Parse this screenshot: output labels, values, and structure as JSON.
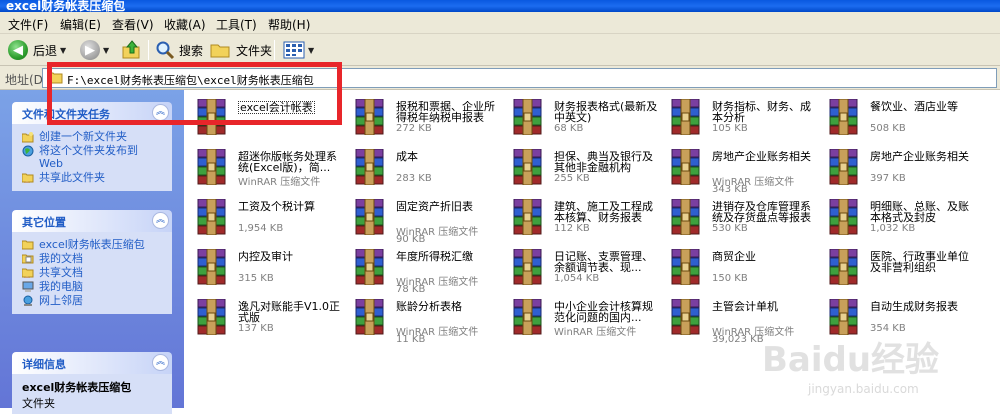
{
  "window": {
    "title": "excel财务帐表压缩包"
  },
  "menu": [
    "文件(F)",
    "编辑(E)",
    "查看(V)",
    "收藏(A)",
    "工具(T)",
    "帮助(H)"
  ],
  "toolbar": {
    "back": "后退",
    "search": "搜索",
    "folders": "文件夹"
  },
  "address": {
    "label": "地址(D)",
    "path": "F:\\excel财务帐表压缩包\\excel财务帐表压缩包"
  },
  "tasks": {
    "title": "文件和文件夹任务",
    "items": [
      "创建一个新文件夹",
      "将这个文件夹发布到 Web",
      "共享此文件夹"
    ]
  },
  "places": {
    "title": "其它位置",
    "items": [
      "excel财务帐表压缩包",
      "我的文档",
      "共享文档",
      "我的电脑",
      "网上邻居"
    ]
  },
  "details": {
    "title": "详细信息",
    "name": "excel财务帐表压缩包",
    "type": "文件夹"
  },
  "files": [
    {
      "name": "excel会计帐表",
      "type": "",
      "size": ""
    },
    {
      "name": "报税和票据、企业所得税年纳税申报表",
      "type": "",
      "size": "272 KB"
    },
    {
      "name": "财务报表格式(最新及中英文)",
      "type": "",
      "size": "68 KB"
    },
    {
      "name": "财务指标、财务、成本分析",
      "type": "",
      "size": "105 KB"
    },
    {
      "name": "餐饮业、酒店业等",
      "type": "",
      "size": "508 KB"
    },
    {
      "name": "超迷你版帐务处理系统(Excel版)，简...",
      "type": "WinRAR 压缩文件",
      "size": ""
    },
    {
      "name": "成本",
      "type": "",
      "size": "283 KB"
    },
    {
      "name": "担保、典当及银行及其他非金融机构",
      "type": "",
      "size": "255 KB"
    },
    {
      "name": "房地产企业账务相关",
      "type": "WinRAR 压缩文件",
      "size": "343 KB"
    },
    {
      "name": "房地产企业账务相关",
      "type": "",
      "size": "397 KB"
    },
    {
      "name": "工资及个税计算",
      "type": "",
      "size": "1,954 KB"
    },
    {
      "name": "固定资产折旧表",
      "type": "WinRAR 压缩文件",
      "size": "90 KB"
    },
    {
      "name": "建筑、施工及工程成本核算、财务报表",
      "type": "",
      "size": "112 KB"
    },
    {
      "name": "进销存及仓库管理系统及存货盘点等报表",
      "type": "",
      "size": "530 KB"
    },
    {
      "name": "明细账、总账、及账本格式及封皮",
      "type": "",
      "size": "1,032 KB"
    },
    {
      "name": "内控及审计",
      "type": "",
      "size": "315 KB"
    },
    {
      "name": "年度所得税汇缴",
      "type": "WinRAR 压缩文件",
      "size": "78 KB"
    },
    {
      "name": "日记账、支票管理、余额调节表、现...",
      "type": "",
      "size": "1,054 KB"
    },
    {
      "name": "商贸企业",
      "type": "",
      "size": "150 KB"
    },
    {
      "name": "医院、行政事业单位及非营利组织",
      "type": "",
      "size": ""
    },
    {
      "name": "逸凡对账能手V1.0正式版",
      "type": "",
      "size": "137 KB"
    },
    {
      "name": "账龄分析表格",
      "type": "WinRAR 压缩文件",
      "size": "11 KB"
    },
    {
      "name": "中小企业会计核算规范化问题的国内...",
      "type": "WinRAR 压缩文件",
      "size": ""
    },
    {
      "name": "主管会计单机",
      "type": "WinRAR 压缩文件",
      "size": "39,023 KB"
    },
    {
      "name": "自动生成财务报表",
      "type": "",
      "size": "354 KB"
    }
  ],
  "watermark": {
    "text": "Baidu经验",
    "url": "jingyan.baidu.com"
  }
}
